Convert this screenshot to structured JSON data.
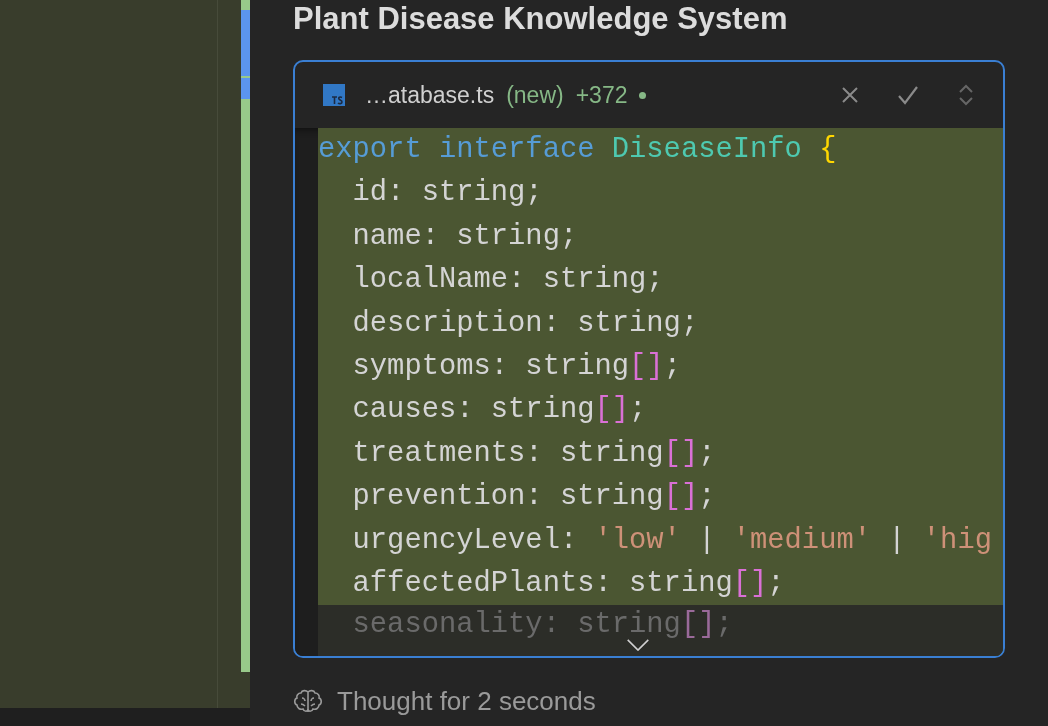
{
  "title": "Plant Disease Knowledge System",
  "diff_card": {
    "file_name": "…atabase.ts",
    "status": "(new)",
    "added": "+372",
    "code_lines": [
      {
        "dimmed": false,
        "tokens": [
          {
            "text": "export ",
            "kind": "keyword"
          },
          {
            "text": "interface ",
            "kind": "keyword"
          },
          {
            "text": "DiseaseInfo ",
            "kind": "type"
          },
          {
            "text": "{",
            "kind": "brace"
          }
        ]
      },
      {
        "dimmed": false,
        "tokens": [
          {
            "text": "  id: string;",
            "kind": "plain"
          }
        ]
      },
      {
        "dimmed": false,
        "tokens": [
          {
            "text": "  name: string;",
            "kind": "plain"
          }
        ]
      },
      {
        "dimmed": false,
        "tokens": [
          {
            "text": "  localName: string;",
            "kind": "plain"
          }
        ]
      },
      {
        "dimmed": false,
        "tokens": [
          {
            "text": "  description: string;",
            "kind": "plain"
          }
        ]
      },
      {
        "dimmed": false,
        "tokens": [
          {
            "text": "  symptoms: string",
            "kind": "plain"
          },
          {
            "text": "[]",
            "kind": "bracket"
          },
          {
            "text": ";",
            "kind": "plain"
          }
        ]
      },
      {
        "dimmed": false,
        "tokens": [
          {
            "text": "  causes: string",
            "kind": "plain"
          },
          {
            "text": "[]",
            "kind": "bracket"
          },
          {
            "text": ";",
            "kind": "plain"
          }
        ]
      },
      {
        "dimmed": false,
        "tokens": [
          {
            "text": "  treatments: string",
            "kind": "plain"
          },
          {
            "text": "[]",
            "kind": "bracket"
          },
          {
            "text": ";",
            "kind": "plain"
          }
        ]
      },
      {
        "dimmed": false,
        "tokens": [
          {
            "text": "  prevention: string",
            "kind": "plain"
          },
          {
            "text": "[]",
            "kind": "bracket"
          },
          {
            "text": ";",
            "kind": "plain"
          }
        ]
      },
      {
        "dimmed": false,
        "tokens": [
          {
            "text": "  urgencyLevel: ",
            "kind": "plain"
          },
          {
            "text": "'low'",
            "kind": "string"
          },
          {
            "text": " | ",
            "kind": "plain"
          },
          {
            "text": "'medium'",
            "kind": "string"
          },
          {
            "text": " | ",
            "kind": "plain"
          },
          {
            "text": "'hig",
            "kind": "string"
          }
        ]
      },
      {
        "dimmed": false,
        "tokens": [
          {
            "text": "  affectedPlants: string",
            "kind": "plain"
          },
          {
            "text": "[]",
            "kind": "bracket"
          },
          {
            "text": ";",
            "kind": "plain"
          }
        ]
      },
      {
        "dimmed": true,
        "tokens": [
          {
            "text": "  seasonality: string",
            "kind": "plain"
          },
          {
            "text": "[]",
            "kind": "bracket"
          },
          {
            "text": ";",
            "kind": "plain"
          }
        ]
      }
    ]
  },
  "thought": {
    "label": "Thought for 2 seconds"
  }
}
